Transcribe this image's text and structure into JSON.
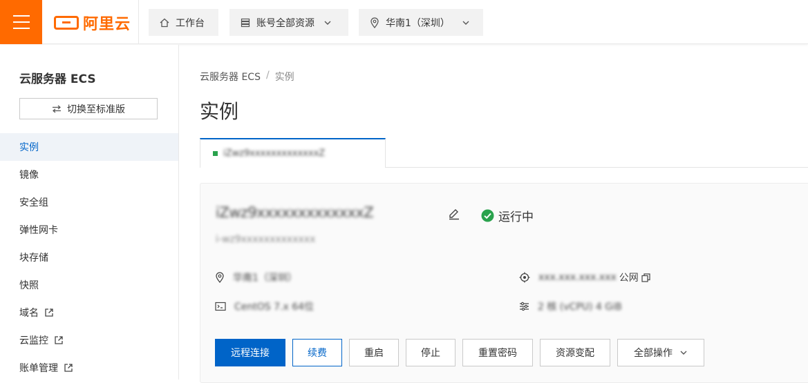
{
  "topbar": {
    "logo_text": "阿里云",
    "workbench": "工作台",
    "resources": "账号全部资源",
    "region": "华南1（深圳）",
    "brand_color": "#ff6a00"
  },
  "sidebar": {
    "title": "云服务器 ECS",
    "switch_label": "切换至标准版",
    "items": [
      {
        "label": "实例",
        "active": true
      },
      {
        "label": "镜像"
      },
      {
        "label": "安全组"
      },
      {
        "label": "弹性网卡"
      },
      {
        "label": "块存储"
      },
      {
        "label": "快照"
      },
      {
        "label": "域名",
        "external": true
      },
      {
        "label": "云监控",
        "external": true
      },
      {
        "label": "账单管理",
        "external": true
      }
    ]
  },
  "main": {
    "breadcrumb": [
      "云服务器 ECS",
      "/",
      "实例"
    ],
    "title": "实例",
    "tab_label": "iZwz9xxxxxxxxxxxxxZ",
    "instance": {
      "name": "iZwz9xxxxxxxxxxxxxZ",
      "id": "i-wz9xxxxxxxxxxxxx",
      "status": "运行中",
      "zone": "华南1（深圳）",
      "os": "CentOS 7.x 64位",
      "public_ip": "xxx.xxx.xxx.xxx",
      "public_label": "公网",
      "spec": "2 核 (vCPU) 4 GiB"
    },
    "actions": [
      "远程连接",
      "续费",
      "重启",
      "停止",
      "重置密码",
      "资源变配",
      "全部操作"
    ],
    "accent_color": "#0064c8",
    "status_color": "#2aa24d"
  }
}
